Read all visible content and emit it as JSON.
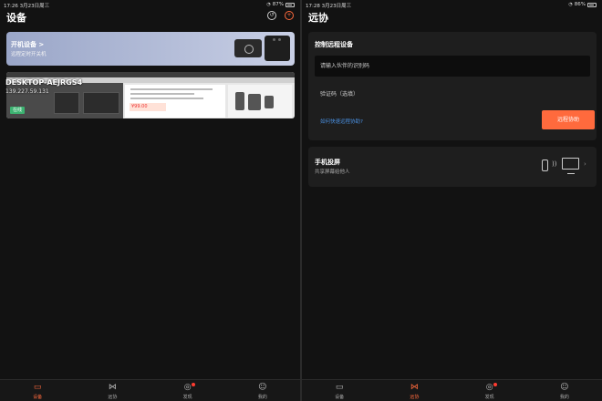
{
  "left": {
    "status": {
      "time": "17:26",
      "date": "3月23日周三",
      "battery": "87%",
      "battery_level": 0.87
    },
    "title": "设备",
    "power_card": {
      "title": "开机设备 >",
      "subtitle": "远程定时开关机"
    },
    "device": {
      "name": "DESKTOP-AEJRGS4",
      "ip": "139.227.59.131",
      "status": "在线",
      "preview_price": "¥99.00"
    },
    "tabs": [
      {
        "label": "设备",
        "icon": "monitor-icon",
        "active": true
      },
      {
        "label": "远协",
        "icon": "remote-icon",
        "active": false
      },
      {
        "label": "发现",
        "icon": "compass-icon",
        "active": false,
        "badge": true
      },
      {
        "label": "我的",
        "icon": "profile-icon",
        "active": false
      }
    ]
  },
  "right": {
    "status": {
      "time": "17:28",
      "date": "3月23日周三",
      "battery": "86%",
      "battery_level": 0.86
    },
    "title": "远协",
    "remote": {
      "title": "控制远程设备",
      "id_placeholder": "请输入伙伴的识别码",
      "code_placeholder": "验证码（选填）",
      "help_link": "如何快速远程协助?",
      "assist_button": "远程协助"
    },
    "screen_cast": {
      "title": "手机投屏",
      "subtitle": "共享屏幕给他人"
    },
    "tabs": [
      {
        "label": "设备",
        "icon": "monitor-icon",
        "active": false
      },
      {
        "label": "远协",
        "icon": "remote-icon",
        "active": true
      },
      {
        "label": "发现",
        "icon": "compass-icon",
        "active": false,
        "badge": true
      },
      {
        "label": "我的",
        "icon": "profile-icon",
        "active": false
      }
    ]
  },
  "colors": {
    "accent": "#ff6a3d",
    "link": "#4a90e2",
    "online": "#3cb371",
    "background": "#121212",
    "card": "#1e1e1e"
  }
}
